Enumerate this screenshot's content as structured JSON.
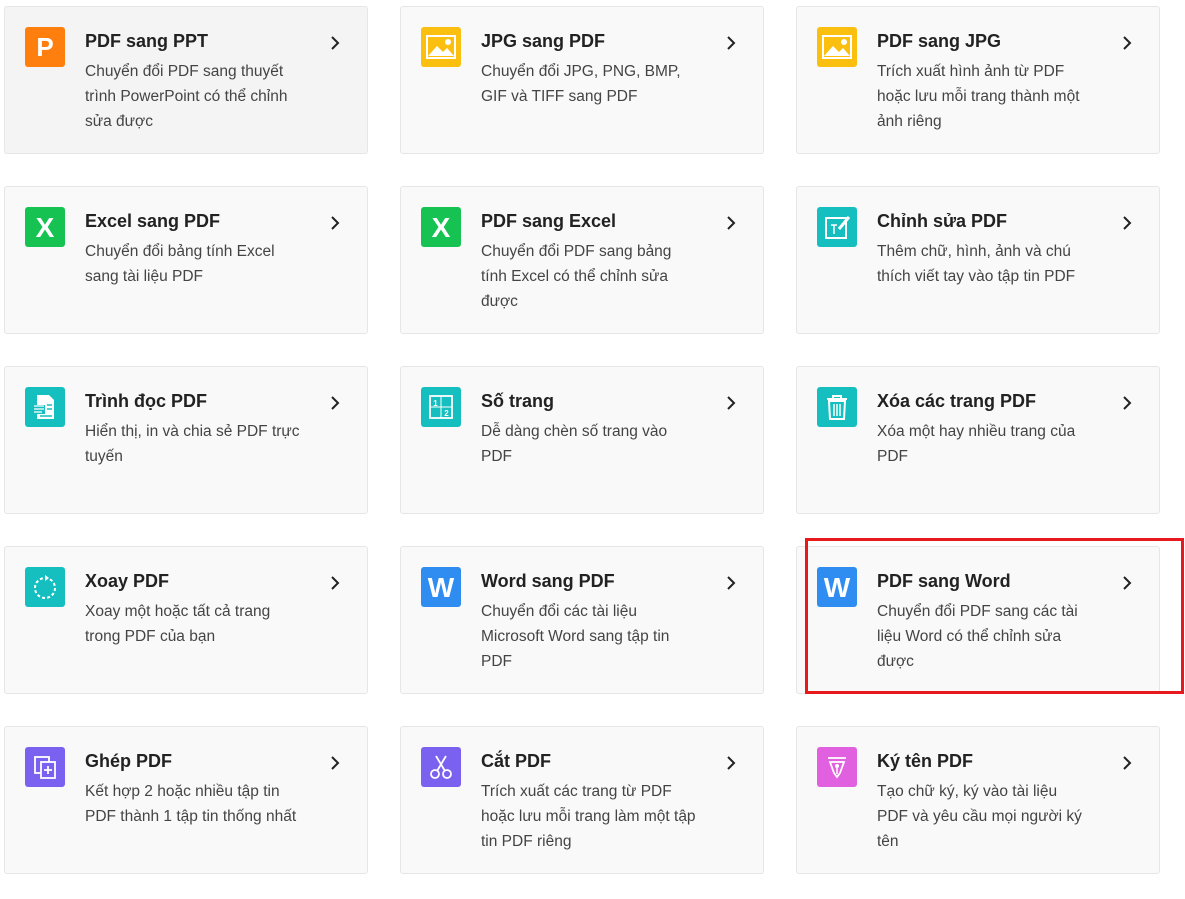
{
  "tools": [
    {
      "title": "PDF sang PPT",
      "desc": "Chuyển đổi PDF sang thuyết trình PowerPoint có thể chỉnh sửa được",
      "icon": "powerpoint-icon",
      "color": "#ff7f0e"
    },
    {
      "title": "JPG sang PDF",
      "desc": "Chuyển đổi JPG, PNG, BMP, GIF và TIFF sang PDF",
      "icon": "image-icon",
      "color": "#fbbf0f"
    },
    {
      "title": "PDF sang JPG",
      "desc": "Trích xuất hình ảnh từ PDF hoặc lưu mỗi trang thành một ảnh riêng",
      "icon": "image-icon",
      "color": "#fbbf0f"
    },
    {
      "title": "Excel sang PDF",
      "desc": "Chuyển đổi bảng tính Excel sang tài liệu PDF",
      "icon": "excel-icon",
      "color": "#16c252"
    },
    {
      "title": "PDF sang Excel",
      "desc": "Chuyển đổi PDF sang bảng tính Excel có thể chỉnh sửa được",
      "icon": "excel-icon",
      "color": "#16c252"
    },
    {
      "title": "Chỉnh sửa PDF",
      "desc": "Thêm chữ, hình, ảnh và chú thích viết tay vào tập tin PDF",
      "icon": "edit-icon",
      "color": "#16bfbf"
    },
    {
      "title": "Trình đọc PDF",
      "desc": "Hiển thị, in và chia sẻ PDF trực tuyến",
      "icon": "reader-icon",
      "color": "#16bfbf"
    },
    {
      "title": "Số trang",
      "desc": "Dễ dàng chèn số trang vào PDF",
      "icon": "page-number-icon",
      "color": "#16bfbf"
    },
    {
      "title": "Xóa các trang PDF",
      "desc": "Xóa một hay nhiều trang của PDF",
      "icon": "trash-icon",
      "color": "#16bfbf"
    },
    {
      "title": "Xoay PDF",
      "desc": "Xoay một hoặc tất cả trang trong PDF của bạn",
      "icon": "rotate-icon",
      "color": "#16bfbf"
    },
    {
      "title": "Word sang PDF",
      "desc": "Chuyển đổi các tài liệu Microsoft Word sang tập tin PDF",
      "icon": "word-icon",
      "color": "#2f8cf0"
    },
    {
      "title": "PDF sang Word",
      "desc": "Chuyển đổi PDF sang các tài liệu Word có thể chỉnh sửa được",
      "icon": "word-icon",
      "color": "#2f8cf0"
    },
    {
      "title": "Ghép PDF",
      "desc": "Kết hợp 2 hoặc nhiều tập tin PDF thành 1 tập tin thống nhất",
      "icon": "merge-icon",
      "color": "#7b61f0"
    },
    {
      "title": "Cắt PDF",
      "desc": "Trích xuất các trang từ PDF hoặc lưu mỗi trang làm một tập tin PDF riêng",
      "icon": "scissors-icon",
      "color": "#7b61f0"
    },
    {
      "title": "Ký tên PDF",
      "desc": "Tạo chữ ký, ký vào tài liệu PDF và yêu cầu mọi người ký tên",
      "icon": "sign-icon",
      "color": "#e060e0"
    }
  ],
  "highlight_index": 11,
  "highlight_color": "#e8191c"
}
